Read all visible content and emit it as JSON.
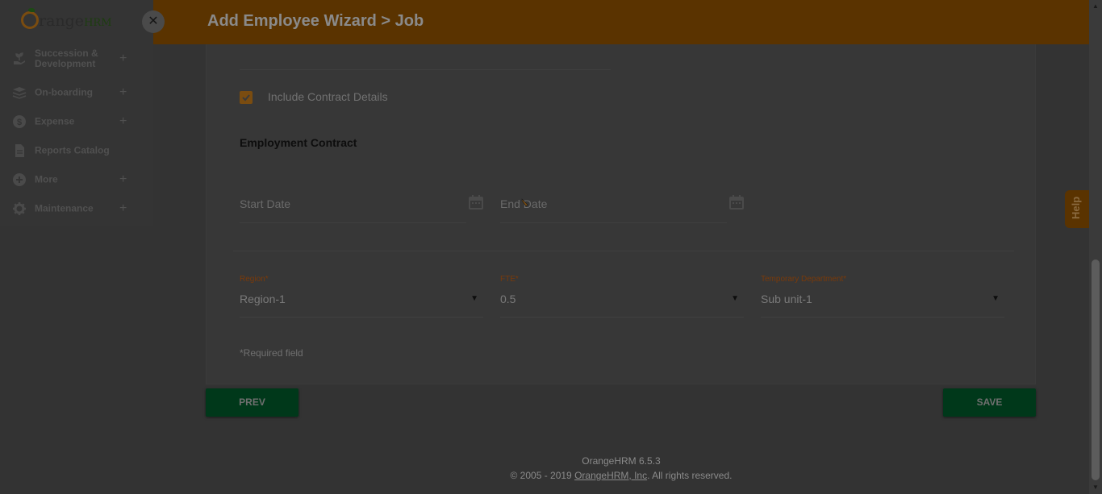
{
  "header": {
    "title": "Add Employee Wizard > Job"
  },
  "sidebar": {
    "logo_text": "range",
    "logo_hrm": "HRM",
    "close_icon": "close-icon",
    "items": [
      {
        "label": "Succession & Development",
        "icon": "plant-hand-icon",
        "expandable": true
      },
      {
        "label": "On-boarding",
        "icon": "layers-icon",
        "expandable": true
      },
      {
        "label": "Expense",
        "icon": "dollar-icon",
        "expandable": true
      },
      {
        "label": "Reports Catalog",
        "icon": "document-icon",
        "expandable": false
      },
      {
        "label": "More",
        "icon": "plus-circle-icon",
        "expandable": true
      },
      {
        "label": "Maintenance",
        "icon": "gear-icon",
        "expandable": true
      }
    ],
    "plus_symbol": "+"
  },
  "form": {
    "include_contract": {
      "label": "Include Contract Details",
      "checked": true
    },
    "section_title": "Employment Contract",
    "start_date": {
      "placeholder": "Start Date"
    },
    "end_date": {
      "placeholder": "End Date"
    },
    "region": {
      "label": "Region",
      "value": "Region-1"
    },
    "fte": {
      "label": "FTE",
      "value": "0.5"
    },
    "temporary_department": {
      "label": "Temporary Department",
      "value": "Sub unit-1"
    },
    "required_marker": "*",
    "required_note": "Required field"
  },
  "buttons": {
    "prev": "PREV",
    "save": "SAVE"
  },
  "footer": {
    "version": "OrangeHRM 6.5.3",
    "copyright_prefix": "© 2005 - 2019 ",
    "company_link": "OrangeHRM, Inc",
    "copyright_suffix": ". All rights reserved."
  },
  "help": {
    "label": "Help"
  },
  "colors": {
    "accent": "#f28c18",
    "brand_green": "#00a651",
    "overlay": "rgba(0,0,0,0.78)"
  }
}
